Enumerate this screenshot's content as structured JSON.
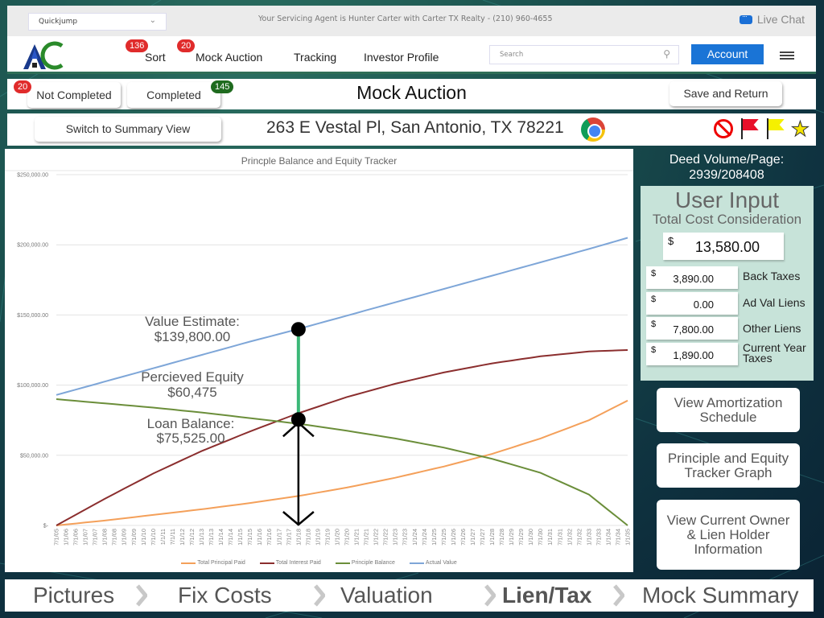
{
  "topbar": {
    "quickjump_value": "Quickjump",
    "agent_text": "Your Servicing Agent is Hunter Carter with Carter TX Realty - (210) 960-4655",
    "live_chat_label": "Live Chat"
  },
  "nav": {
    "items": [
      {
        "label": "Sort",
        "badge": "136"
      },
      {
        "label": "Mock Auction",
        "badge": "20"
      },
      {
        "label": "Tracking"
      },
      {
        "label": "Investor Profile"
      }
    ],
    "search_placeholder": "Search",
    "account_label": "Account"
  },
  "status": {
    "not_completed_label": "Not Completed",
    "not_completed_count": "20",
    "completed_label": "Completed",
    "completed_count": "145",
    "page_title": "Mock Auction",
    "save_label": "Save and Return"
  },
  "property": {
    "switch_label": "Switch to Summary View",
    "address": "263 E Vestal Pl, San Antonio, TX 78221",
    "icons": [
      "no-entry-icon",
      "red-flag-icon",
      "yellow-flag-icon",
      "star-icon"
    ]
  },
  "chart_data": {
    "type": "line",
    "title": "Princple Balance and Equity Tracker",
    "xlabel": "",
    "ylabel": "",
    "ylim": [
      0,
      250000
    ],
    "y_ticks": [
      "$-",
      "$50,000.00",
      "$100,000.00",
      "$150,000.00",
      "$200,000.00",
      "$250,000.00"
    ],
    "y_tick_values": [
      0,
      50000,
      100000,
      150000,
      200000,
      250000
    ],
    "grid": true,
    "legend_position": "bottom",
    "x": [
      "7/1/05",
      "1/1/06",
      "7/1/06",
      "1/1/07",
      "7/1/07",
      "1/1/08",
      "7/1/08",
      "1/1/09",
      "7/1/09",
      "1/1/10",
      "7/1/10",
      "1/1/11",
      "7/1/11",
      "1/1/12",
      "7/1/12",
      "1/1/13",
      "7/1/13",
      "1/1/14",
      "7/1/14",
      "1/1/15",
      "7/1/15",
      "1/1/16",
      "7/1/16",
      "1/1/17",
      "7/1/17",
      "1/1/18",
      "7/1/18",
      "1/1/19",
      "7/1/19",
      "1/1/20",
      "7/1/20",
      "1/1/21",
      "7/1/21",
      "1/1/22",
      "7/1/22",
      "1/1/23",
      "7/1/23",
      "1/1/24",
      "7/1/24",
      "1/1/25",
      "7/1/25",
      "1/1/26",
      "7/1/26",
      "1/1/27",
      "7/1/27",
      "1/1/28",
      "7/1/28",
      "1/1/29",
      "7/1/29",
      "1/1/30",
      "7/1/30",
      "1/1/31",
      "7/1/31",
      "1/1/32",
      "7/1/32",
      "1/1/33",
      "7/1/33",
      "1/1/34",
      "7/1/34",
      "1/1/35"
    ],
    "sample_index": [
      0,
      5,
      10,
      15,
      20,
      25,
      30,
      35,
      40,
      45,
      50,
      55,
      59
    ],
    "series": [
      {
        "name": "Total Principal Paid",
        "color": "#f4a05a",
        "values": [
          0,
          3500,
          7500,
          11500,
          16000,
          21000,
          27000,
          34000,
          42000,
          51000,
          62000,
          75000,
          89000
        ]
      },
      {
        "name": "Total Interest Paid",
        "color": "#8b2e2e",
        "values": [
          0,
          19000,
          37000,
          53000,
          67000,
          80000,
          91500,
          101000,
          109000,
          115500,
          120500,
          124000,
          125000
        ]
      },
      {
        "name": "Principle Balance",
        "color": "#6b8e3a",
        "values": [
          90000,
          87000,
          84000,
          80500,
          76500,
          72500,
          67500,
          62000,
          55500,
          47500,
          37500,
          22000,
          0
        ]
      },
      {
        "name": "Actual Value",
        "color": "#7ea6d8",
        "values": [
          93000,
          102500,
          112000,
          121500,
          131000,
          140000,
          149500,
          159000,
          168500,
          178000,
          187500,
          197000,
          205000
        ]
      }
    ],
    "annotations": {
      "value_estimate_label": "Value Estimate:",
      "value_estimate": "$139,800.00",
      "equity_label": "Percieved Equity",
      "equity": "$60,475",
      "loan_label": "Loan Balance:",
      "loan": "$75,525.00",
      "marker_x": "1/1/18",
      "marker_value_top": 139800,
      "marker_value_bottom": 75525,
      "equity_color": "#3cb878"
    }
  },
  "right_panel": {
    "deed_label": "Deed Volume/Page:",
    "deed_value": "2939/208408",
    "user_input_title": "User Input",
    "total_cost_label": "Total Cost Consideration",
    "currency": "$",
    "total_cost": "13,580.00",
    "fields": [
      {
        "label": "Back Taxes",
        "value": "3,890.00"
      },
      {
        "label": "Ad Val Liens",
        "value": "0.00"
      },
      {
        "label": "Other Liens",
        "value": "7,800.00"
      },
      {
        "label": "Current Year Taxes",
        "value": "1,890.00"
      }
    ],
    "buttons": [
      "View Amortization Schedule",
      "Principle and Equity Tracker Graph",
      "View Current Owner & Lien Holder Information"
    ]
  },
  "steps": {
    "items": [
      "Pictures",
      "Fix Costs",
      "Valuation",
      "Lien/Tax",
      "Mock Summary"
    ],
    "active_index": 3
  }
}
